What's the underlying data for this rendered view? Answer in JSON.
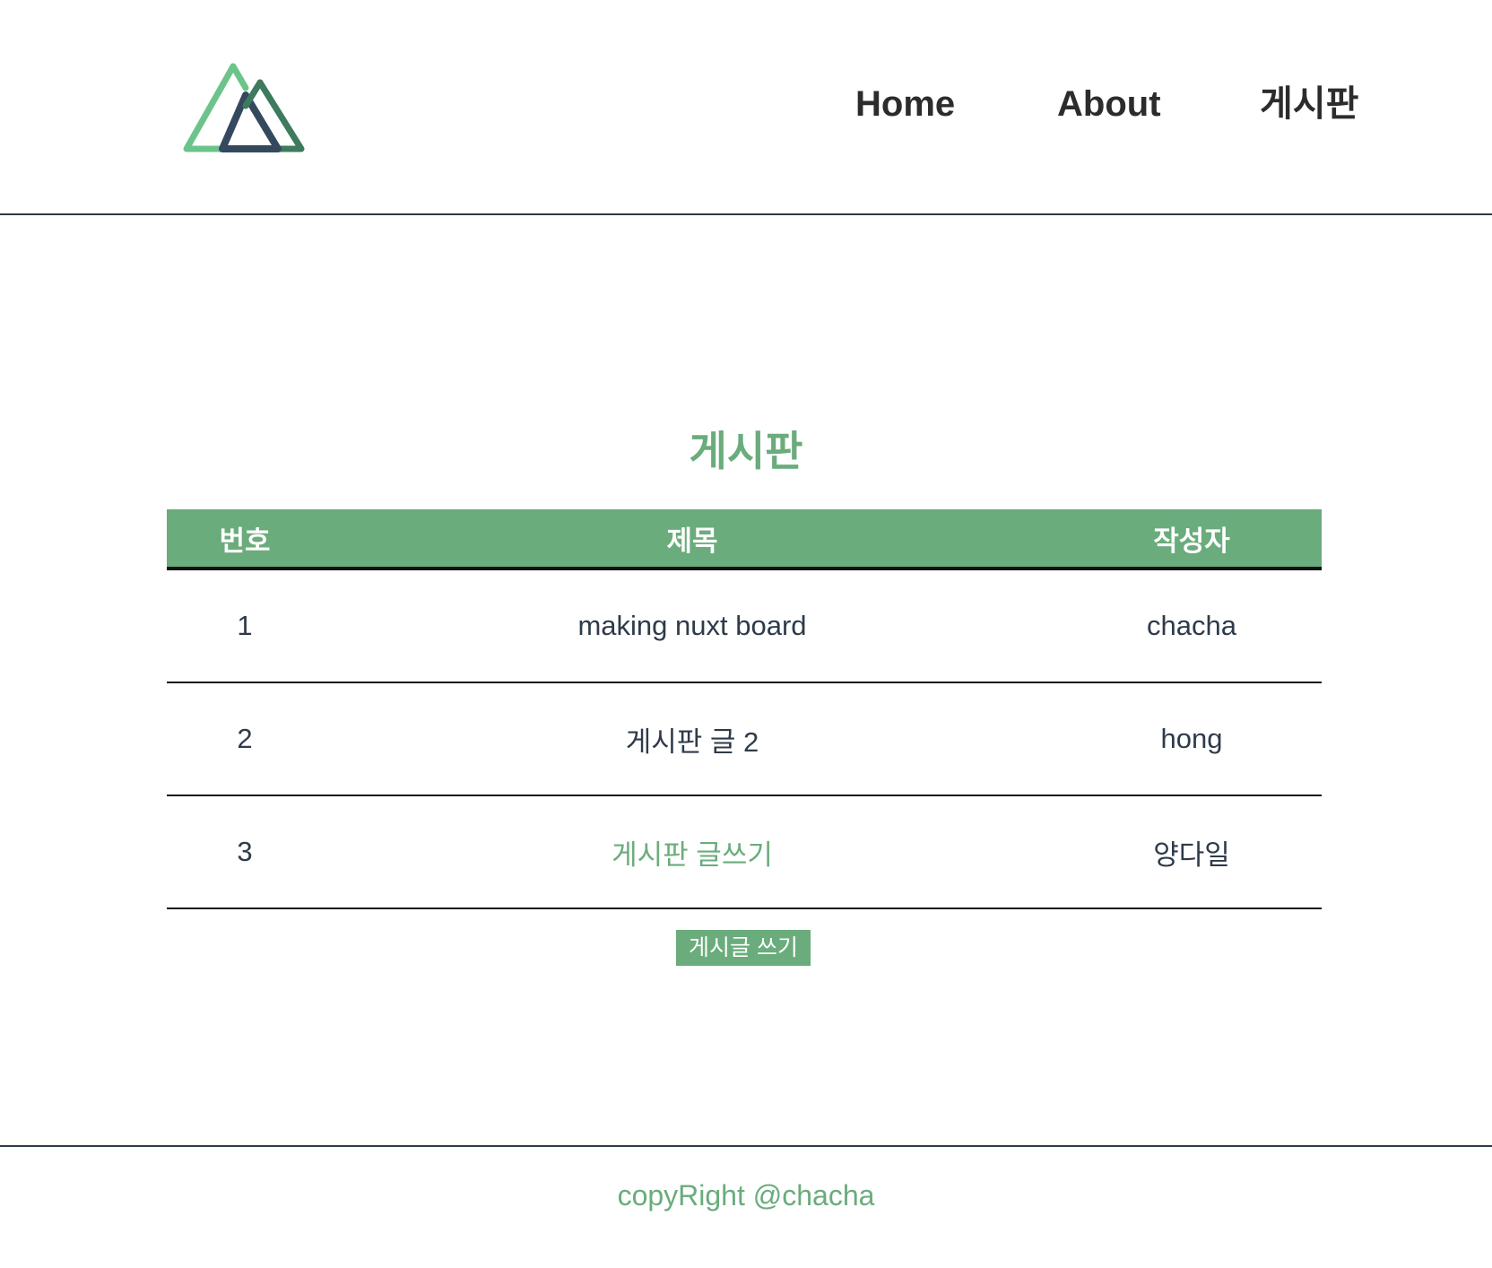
{
  "header": {
    "logo_alt": "Nuxt",
    "nav": {
      "home": "Home",
      "about": "About",
      "board": "게시판"
    }
  },
  "main": {
    "title": "게시판",
    "table": {
      "headers": [
        "번호",
        "제목",
        "작성자"
      ],
      "rows": [
        {
          "no": "1",
          "title": "making nuxt board",
          "author": "chacha"
        },
        {
          "no": "2",
          "title": "게시판 글 2",
          "author": "hong"
        },
        {
          "no": "3",
          "title": "게시판 글쓰기",
          "author": "양다일"
        }
      ]
    },
    "write_button": "게시글 쓰기"
  },
  "footer": {
    "text": "copyRight @chacha"
  },
  "colors": {
    "accent": "#6aac7c",
    "text": "#2f3a4a",
    "logo_dark": "#35495e",
    "logo_light": "#6cc48b",
    "logo_mid": "#3e7a5e"
  }
}
